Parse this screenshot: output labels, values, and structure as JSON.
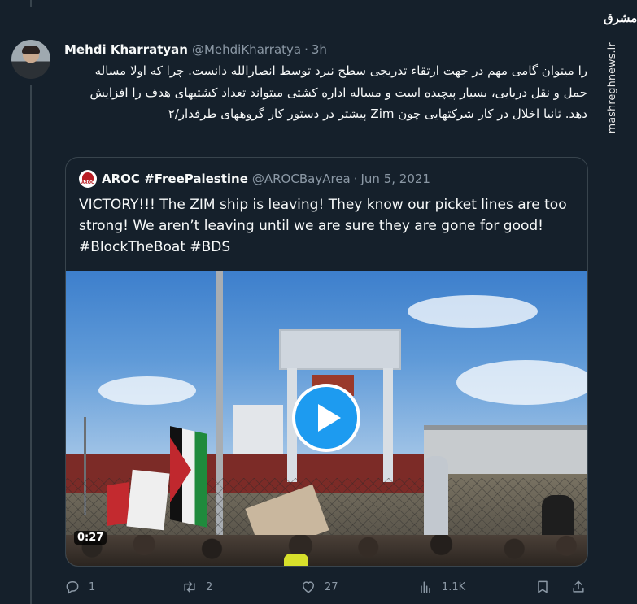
{
  "tweet": {
    "author_name": "Mehdi Kharratyan",
    "author_handle": "@MehdiKharratya",
    "separator": "·",
    "time": "3h",
    "text": "را میتوان گامی مهم در جهت ارتقاء تدریجی سطح نبرد توسط انصارالله دانست. چرا که اولا مساله حمل و نقل دریایی، بسیار پیچیده است و مساله اداره کشتی میتواند تعداد کشتیهای هدف را افزایش دهد. ثانیا اخلال در کار شرکتهایی چون Zim پیشتر در دستور کار گروههای طرفدار/۲"
  },
  "quoted_tweet": {
    "author_name": "AROC #FreePalestine",
    "author_handle": "@AROCBayArea",
    "separator": "·",
    "date": "Jun 5, 2021",
    "avatar_text": "AROC",
    "text": "VICTORY!!! The ZIM ship is leaving! They know our picket lines are too strong! We aren’t leaving until we are sure they are gone for good! #BlockTheBoat #BDS",
    "video": {
      "duration": "0:27"
    }
  },
  "actions": {
    "reply": {
      "icon": "reply-icon",
      "count": "1"
    },
    "retweet": {
      "icon": "retweet-icon",
      "count": "2"
    },
    "like": {
      "icon": "heart-icon",
      "count": "27"
    },
    "views": {
      "icon": "views-icon",
      "count": "1.1K"
    },
    "bookmark": {
      "icon": "bookmark-icon"
    },
    "share": {
      "icon": "share-icon"
    }
  },
  "watermark": {
    "logo": "مشرق",
    "site": "mashreghnews.ir"
  },
  "colors": {
    "background": "#15202b",
    "border": "#38444d",
    "text_primary": "#f7f9f9",
    "text_secondary": "#8b98a5",
    "accent": "#1d9bf0"
  }
}
